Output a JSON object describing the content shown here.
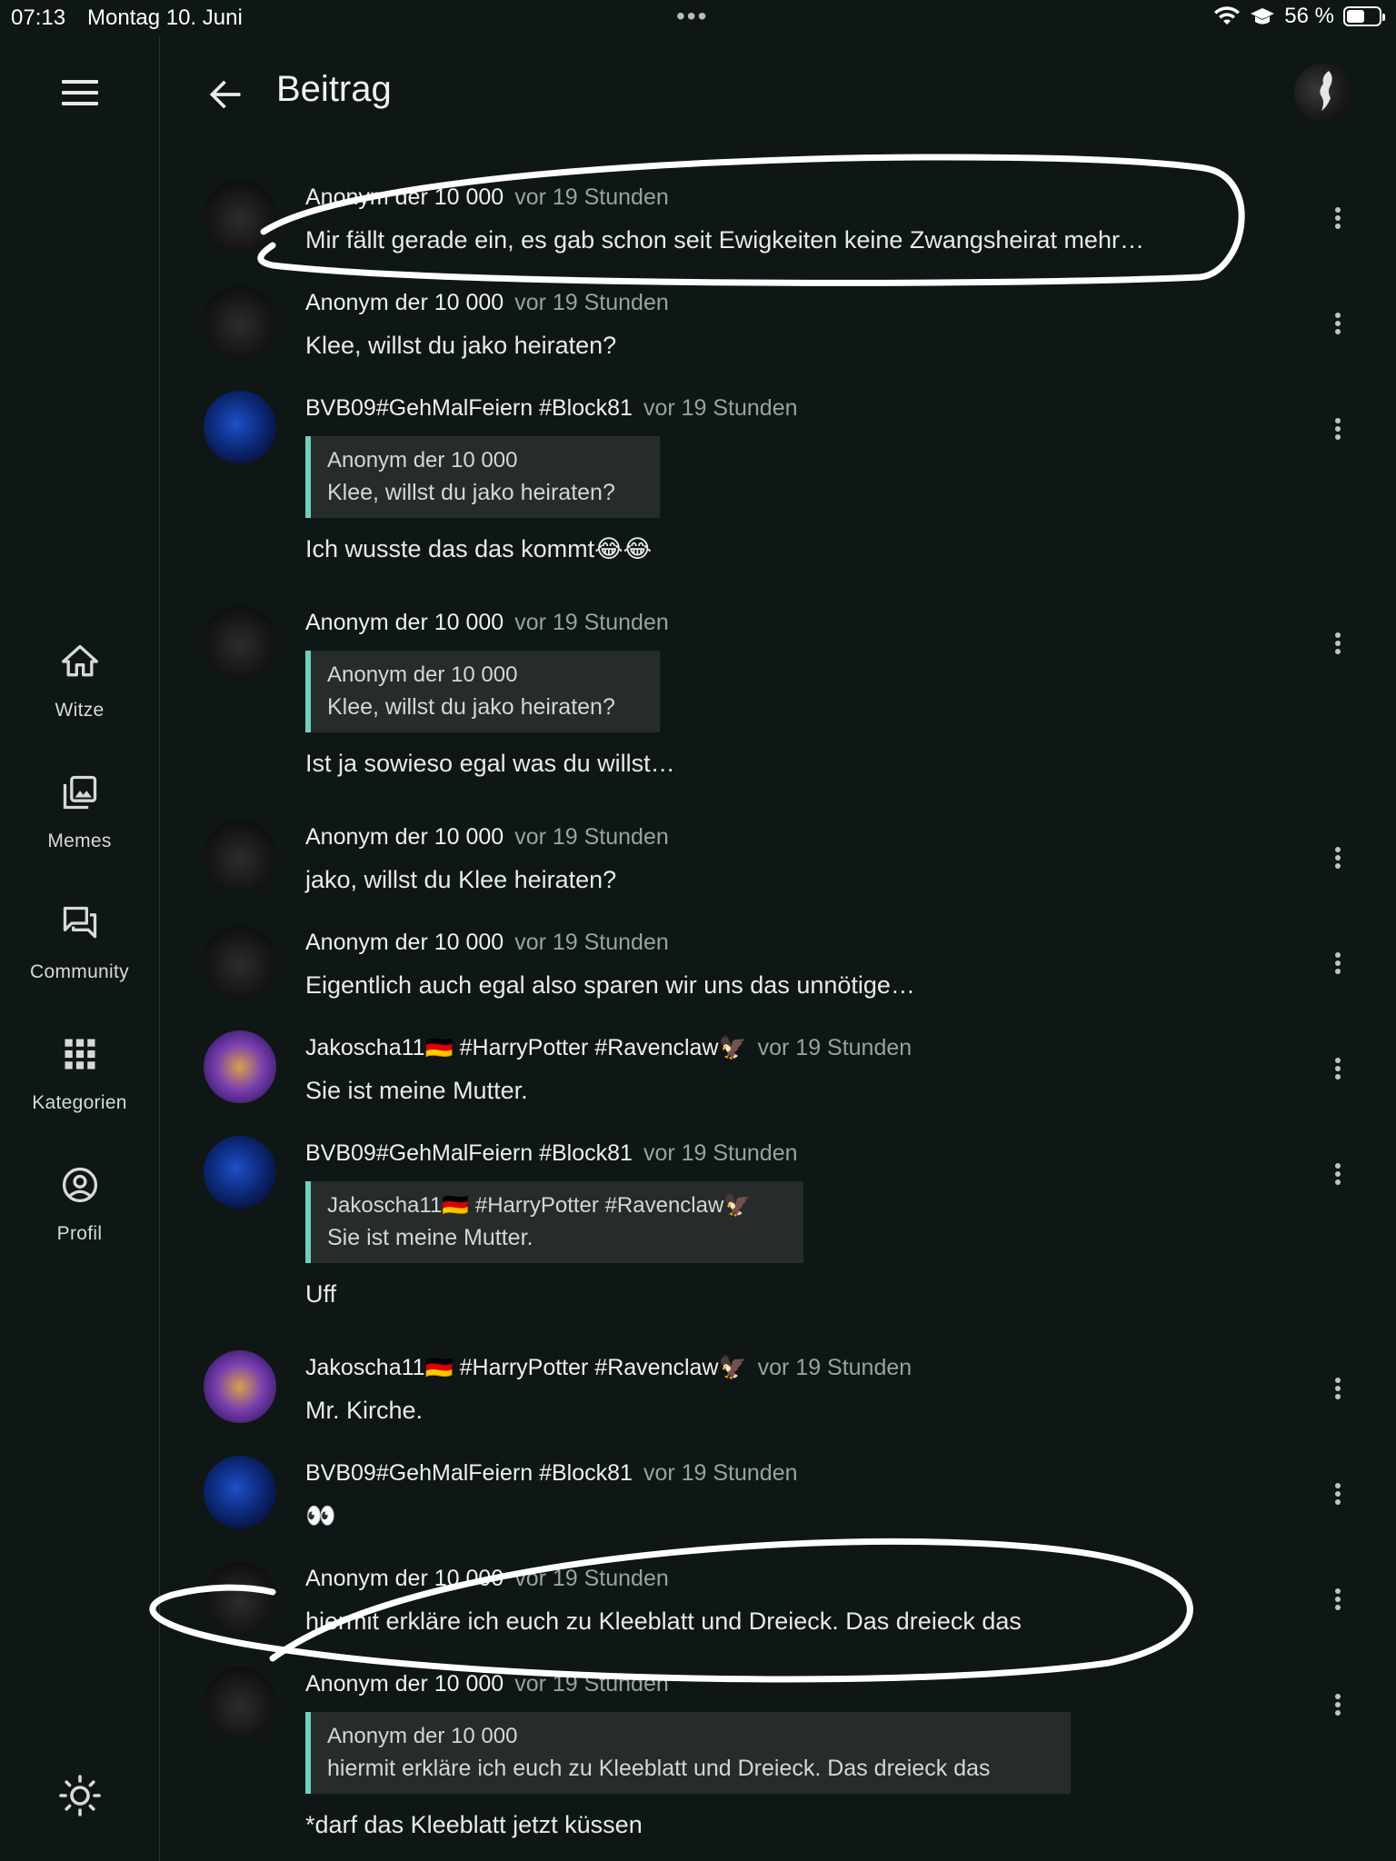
{
  "status_bar": {
    "time": "07:13",
    "date": "Montag 10. Juni",
    "dots": "•••",
    "battery": "56 %",
    "battery_level": 0.56
  },
  "sidebar": {
    "menu_icon": "hamburger-menu-icon",
    "items": [
      {
        "label": "Witze",
        "icon": "home-icon"
      },
      {
        "label": "Memes",
        "icon": "images-icon"
      },
      {
        "label": "Community",
        "icon": "forum-icon"
      },
      {
        "label": "Kategorien",
        "icon": "grid-icon"
      },
      {
        "label": "Profil",
        "icon": "account-circle-icon"
      }
    ],
    "theme_icon": "sun-icon"
  },
  "header": {
    "title": "Beitrag"
  },
  "comments": [
    {
      "author": "Anonym der 10 000",
      "time": "vor 19 Stunden",
      "text": "Mir fällt gerade ein, es gab schon seit Ewigkeiten keine Zwangsheirat mehr…",
      "avatar": "anon"
    },
    {
      "author": "Anonym der 10 000",
      "time": "vor 19 Stunden",
      "text": "Klee, willst du jako heiraten?",
      "avatar": "anon"
    },
    {
      "author": "BVB09#GehMalFeiern #Block81",
      "time": "vor 19 Stunden",
      "quote_author": "Anonym der 10 000",
      "quote_text": "Klee, willst du jako heiraten?",
      "text": "Ich wusste das das kommt😂😂",
      "avatar": "bvb"
    },
    {
      "author": "Anonym der 10 000",
      "time": "vor 19 Stunden",
      "quote_author": "Anonym der 10 000",
      "quote_text": "Klee, willst du jako heiraten?",
      "text": "Ist ja sowieso egal was du willst…",
      "avatar": "anon"
    },
    {
      "author": "Anonym der 10 000",
      "time": "vor 19 Stunden",
      "text": "jako, willst du Klee heiraten?",
      "avatar": "anon"
    },
    {
      "author": "Anonym der 10 000",
      "time": "vor 19 Stunden",
      "text": "Eigentlich auch egal also sparen wir uns das unnötige…",
      "avatar": "anon"
    },
    {
      "author": "Jakoscha11🇩🇪 #HarryPotter #Ravenclaw🦅",
      "time": "vor 19 Stunden",
      "text": "Sie ist meine Mutter.",
      "avatar": "jako"
    },
    {
      "author": "BVB09#GehMalFeiern #Block81",
      "time": "vor 19 Stunden",
      "quote_author": "Jakoscha11🇩🇪 #HarryPotter #Ravenclaw🦅",
      "quote_text": "Sie ist meine Mutter.",
      "text": "Uff",
      "avatar": "bvb"
    },
    {
      "author": "Jakoscha11🇩🇪 #HarryPotter #Ravenclaw🦅",
      "time": "vor 19 Stunden",
      "text": "Mr. Kirche.",
      "avatar": "jako"
    },
    {
      "author": "BVB09#GehMalFeiern #Block81",
      "time": "vor 19 Stunden",
      "text": "👀",
      "avatar": "bvb"
    },
    {
      "author": "Anonym der 10 000",
      "time": "vor 19 Stunden",
      "text": "hiermit erkläre ich euch zu Kleeblatt und Dreieck. Das dreieck das",
      "avatar": "anon"
    },
    {
      "author": "Anonym der 10 000",
      "time": "vor 19 Stunden",
      "quote_author": "Anonym der 10 000",
      "quote_text": "hiermit erkläre ich euch zu Kleeblatt und Dreieck. Das dreieck das",
      "text": "*darf das Kleeblatt jetzt küssen",
      "avatar": "anon"
    }
  ],
  "colors": {
    "background": "#0f1616",
    "quote_bar": "#6fd0c0",
    "quote_bg": "#262b2b",
    "muted": "#9aa1a1"
  }
}
